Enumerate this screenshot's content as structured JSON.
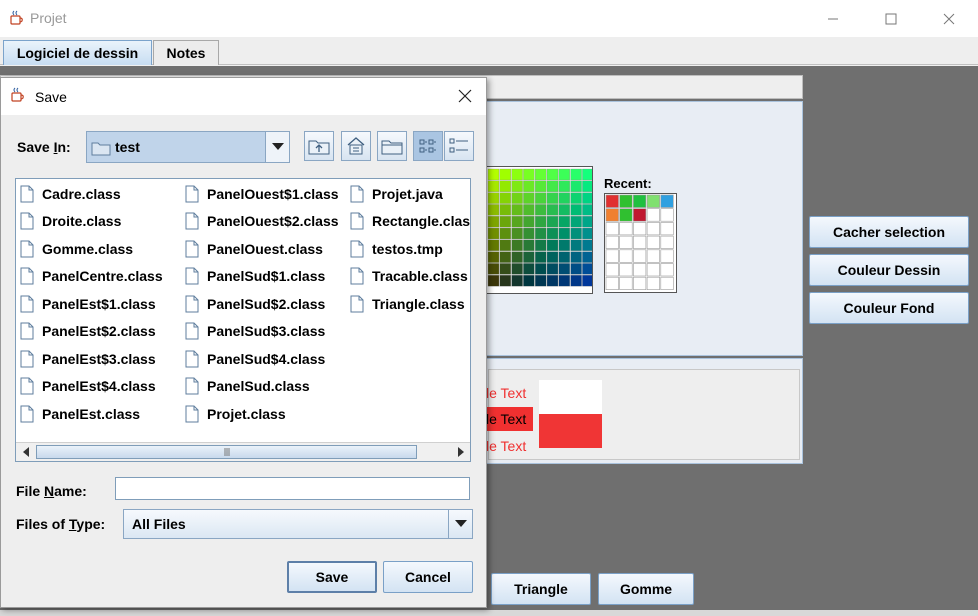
{
  "window": {
    "title": "Projet",
    "controls": {
      "minimize": "—",
      "maximize": "☐",
      "close": "✕"
    }
  },
  "tabs": [
    {
      "label": "Logiciel de dessin",
      "active": true
    },
    {
      "label": "Notes",
      "active": false
    }
  ],
  "color_chooser": {
    "recent_label": "Recent:",
    "recent_colors": [
      "#e03030",
      "#30c030",
      "#20c040",
      "#80e070",
      "#30a0e0",
      "#f08030",
      "#30c030",
      "#c01830"
    ],
    "preview": {
      "sample_text_1": "le Text",
      "sample_text_2": "le Text",
      "sample_text_3": "le Text",
      "foreground": "#f03030",
      "background": "#ffffff"
    }
  },
  "side_buttons": {
    "cacher": "Cacher selection",
    "couleur_dessin": "Couleur Dessin",
    "couleur_fond": "Couleur Fond"
  },
  "bottom_buttons": {
    "triangle": "Triangle",
    "gomme": "Gomme"
  },
  "dialog": {
    "title": "Save",
    "close": "✕",
    "save_in": {
      "label_pre": "Save ",
      "label_mn": "I",
      "label_post": "n:",
      "value": "test"
    },
    "files_col1": [
      "Cadre.class",
      "Droite.class",
      "Gomme.class",
      "PanelCentre.class",
      "PanelEst$1.class",
      "PanelEst$2.class",
      "PanelEst$3.class",
      "PanelEst$4.class",
      "PanelEst.class"
    ],
    "files_col2": [
      "PanelOuest$1.class",
      "PanelOuest$2.class",
      "PanelOuest.class",
      "PanelSud$1.class",
      "PanelSud$2.class",
      "PanelSud$3.class",
      "PanelSud$4.class",
      "PanelSud.class",
      "Projet.class"
    ],
    "files_col3": [
      "Projet.java",
      "Rectangle.class",
      "testos.tmp",
      "Tracable.class",
      "Triangle.class"
    ],
    "file_name": {
      "label_pre": "File ",
      "label_mn": "N",
      "label_post": "ame:",
      "value": ""
    },
    "file_type": {
      "label_pre": "Files of ",
      "label_mn": "T",
      "label_post": "ype:",
      "value": "All Files"
    },
    "save_button": "Save",
    "cancel_button": "Cancel",
    "accent": "#c0d4ea"
  }
}
